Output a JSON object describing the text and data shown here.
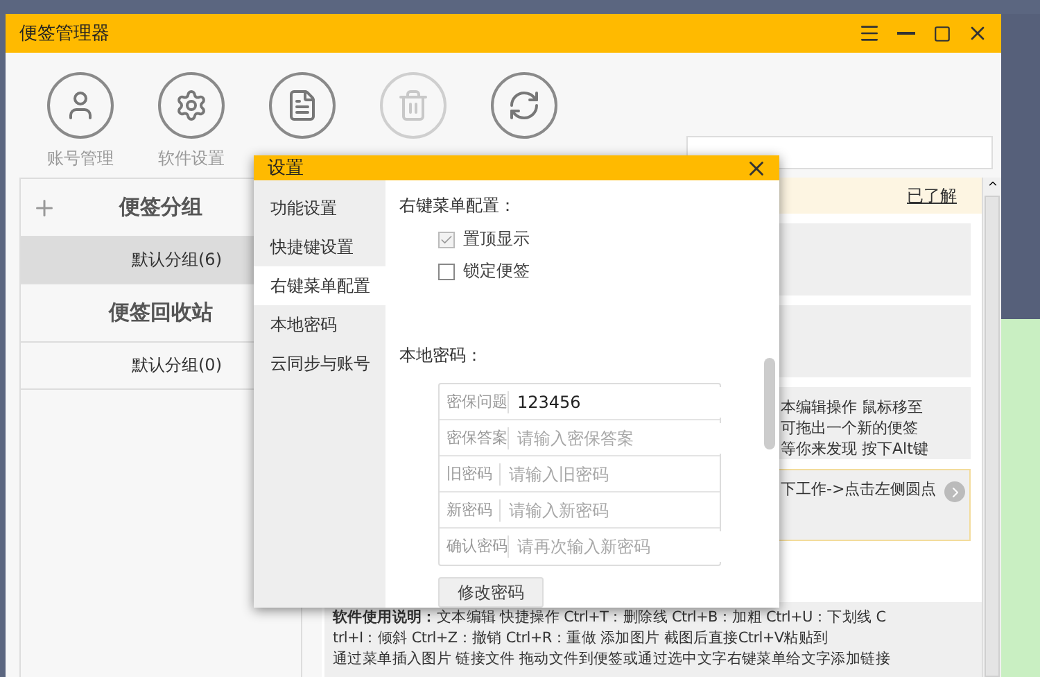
{
  "window": {
    "title": "便签管理器"
  },
  "toolbar": [
    {
      "label": "账号管理",
      "disabled": false
    },
    {
      "label": "软件设置",
      "disabled": false
    },
    {
      "disabled": false
    },
    {
      "disabled": true
    },
    {
      "disabled": false
    }
  ],
  "sidebar": {
    "groups": [
      {
        "title": "便签分组",
        "items": [
          {
            "label": "默认分组(6)",
            "selected": true
          }
        ]
      },
      {
        "title": "便签回收站",
        "items": [
          {
            "label": "默认分组(0)",
            "selected": false
          }
        ]
      }
    ]
  },
  "notice": {
    "link": "已了解"
  },
  "notes": [
    {
      "kind": "plain"
    },
    {
      "kind": "plain"
    },
    {
      "kind": "plain",
      "lines": [
        "本编辑操作  鼠标移至",
        "可拖出一个新的便签",
        "等你来发现  按下Alt键"
      ]
    },
    {
      "kind": "highlight",
      "lines": [
        "下工作->点击左侧圆点"
      ]
    }
  ],
  "instructions": {
    "lines": [
      "**软件使用说明：**文本编辑  快捷操作 Ctrl+T：删除线 Ctrl+B：加粗 Ctrl+U：下划线 C",
      "trl+I：倾斜 Ctrl+Z：撤销 Ctrl+R：重做  添加图片 截图后直接Ctrl+V粘贴到",
      "通过菜单插入图片  链接文件 拖动文件到便签或通过选中文字右键菜单给文字添加链接"
    ]
  },
  "dialog": {
    "title": "设置",
    "nav": [
      {
        "label": "功能设置",
        "selected": false
      },
      {
        "label": "快捷键设置",
        "selected": false
      },
      {
        "label": "右键菜单配置",
        "selected": true
      },
      {
        "label": "本地密码",
        "selected": false
      },
      {
        "label": "云同步与账号",
        "selected": false
      }
    ],
    "context_menu": {
      "heading": "右键菜单配置：",
      "options": [
        {
          "label": "置顶显示",
          "checked": true
        },
        {
          "label": "锁定便签",
          "checked": false
        }
      ]
    },
    "password": {
      "heading": "本地密码：",
      "fields": [
        {
          "label": "密保问题",
          "value": "123456"
        },
        {
          "label": "密保答案",
          "placeholder": "请输入密保答案"
        },
        {
          "label": "旧密码",
          "placeholder": "请输入旧密码"
        },
        {
          "label": "新密码",
          "placeholder": "请输入新密码"
        },
        {
          "label": "确认密码",
          "placeholder": "请再次输入新密码"
        }
      ],
      "button": "修改密码"
    }
  }
}
